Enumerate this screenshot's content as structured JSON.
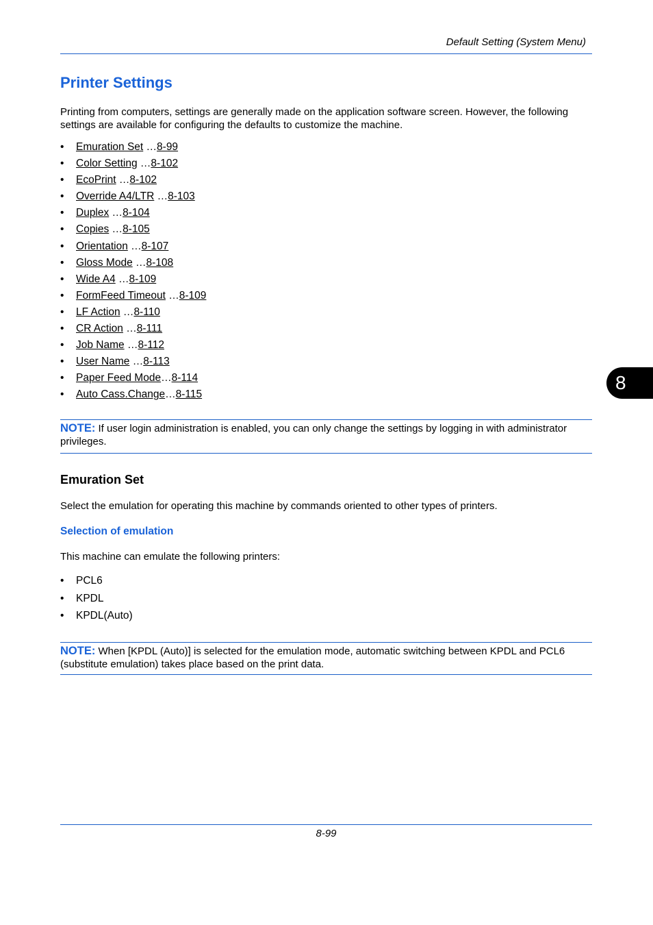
{
  "header": {
    "running_title": "Default Setting (System Menu)"
  },
  "section": {
    "title": "Printer Settings",
    "intro": "Printing from computers, settings are generally made on the application software screen. However, the following settings are available for configuring the defaults to customize the machine.",
    "links": [
      {
        "label": "Emuration Set",
        "sep": " …",
        "page": "8-99"
      },
      {
        "label": "Color Setting",
        "sep": " …",
        "page": "8-102"
      },
      {
        "label": "EcoPrint",
        "sep": " …",
        "page": "8-102"
      },
      {
        "label": "Override A4/LTR",
        "sep": " …",
        "page": "8-103"
      },
      {
        "label": "Duplex",
        "sep": " …",
        "page": "8-104"
      },
      {
        "label": "Copies",
        "sep": " …",
        "page": "8-105"
      },
      {
        "label": "Orientation",
        "sep": " …",
        "page": "8-107"
      },
      {
        "label": "Gloss Mode",
        "sep": " …",
        "page": "8-108"
      },
      {
        "label": "Wide A4",
        "sep": " …",
        "page": "8-109"
      },
      {
        "label": "FormFeed Timeout",
        "sep": " …",
        "page": "8-109"
      },
      {
        "label": "LF Action",
        "sep": " …",
        "page": "8-110"
      },
      {
        "label": "CR Action",
        "sep": " …",
        "page": "8-111"
      },
      {
        "label": "Job Name",
        "sep": " …",
        "page": "8-112"
      },
      {
        "label": "User Name",
        "sep": " …",
        "page": "8-113"
      },
      {
        "label": "Paper Feed Mode",
        "sep": "…",
        "page": "8-114"
      },
      {
        "label": "Auto Cass.Change",
        "sep": "…",
        "page": "8-115"
      }
    ],
    "note1": {
      "label": "NOTE:",
      "text": " If user login administration is enabled, you can only change the settings by logging in with administrator privileges."
    }
  },
  "subsection": {
    "title": "Emuration Set",
    "description": "Select the emulation for operating this machine by commands oriented to other types of printers.",
    "subheading": "Selection of emulation",
    "list_intro": "This machine can emulate the following printers:",
    "printers": [
      "PCL6",
      "KPDL",
      "KPDL(Auto)"
    ],
    "note2": {
      "label": "NOTE:",
      "text": " When [KPDL (Auto)] is selected for the emulation mode, automatic switching between KPDL and PCL6 (substitute emulation) takes place based on the print data."
    }
  },
  "footer": {
    "page_number": "8-99"
  },
  "chapter_tab": {
    "number": "8"
  },
  "colors": {
    "accent": "#1a63d8",
    "rule": "#1a5fc8"
  }
}
